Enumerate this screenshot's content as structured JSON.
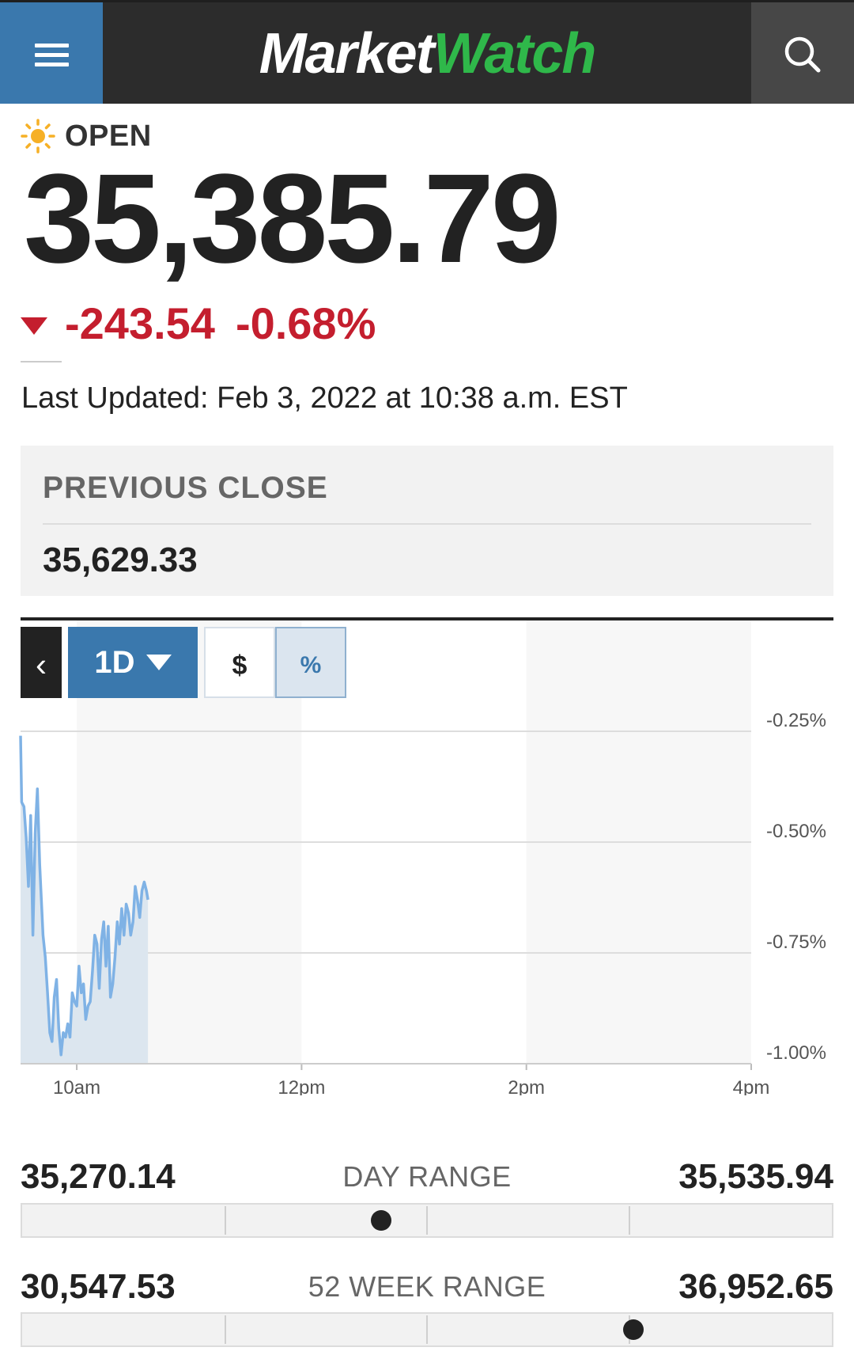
{
  "header": {
    "logo_part1": "Market",
    "logo_part2": "Watch",
    "menu_icon": "hamburger-menu-icon",
    "search_icon": "search-icon",
    "colors": {
      "bar": "#2c2c2c",
      "menu": "#3a78ad",
      "search": "#474747",
      "logo_green": "#2fb84a"
    }
  },
  "quote": {
    "market_status": "OPEN",
    "status_icon": "sun-icon",
    "price": "35,385.79",
    "change": "-243.54",
    "change_percent": "-0.68%",
    "direction_icon": "down-triangle-icon",
    "change_color": "#c41e2e",
    "last_updated": "Last Updated: Feb 3, 2022 at 10:38 a.m. EST"
  },
  "previous_close": {
    "label": "PREVIOUS CLOSE",
    "value": "35,629.33"
  },
  "chart_controls": {
    "back_label": "‹",
    "range_label": "1D",
    "dollar_label": "$",
    "percent_label": "%",
    "selected_mode": "%"
  },
  "chart_data": {
    "type": "area",
    "title": "",
    "xlabel": "",
    "ylabel": "",
    "x_ticks": [
      "10am",
      "12pm",
      "2pm",
      "4pm"
    ],
    "y_ticks": [
      "-0.25%",
      "-0.50%",
      "-0.75%",
      "-1.00%"
    ],
    "ylim": [
      -1.0,
      -0.2
    ],
    "xlim_hours": [
      9.5,
      16.0
    ],
    "grid": true,
    "line_color": "#7fb2e5",
    "fill_color": "#dce6ef",
    "series": [
      {
        "x": [
          9.5,
          9.51,
          9.53,
          9.55,
          9.57,
          9.59,
          9.61,
          9.63,
          9.65,
          9.67,
          9.7,
          9.72,
          9.74,
          9.76,
          9.78,
          9.8,
          9.82,
          9.84,
          9.86,
          9.88,
          9.9,
          9.92,
          9.94,
          9.96,
          9.98,
          10.0,
          10.02,
          10.04,
          10.06,
          10.08,
          10.1,
          10.12,
          10.14,
          10.16,
          10.18,
          10.2,
          10.22,
          10.24,
          10.26,
          10.28,
          10.3,
          10.32,
          10.34,
          10.36,
          10.38,
          10.4,
          10.42,
          10.44,
          10.46,
          10.48,
          10.5,
          10.52,
          10.54,
          10.56,
          10.58,
          10.6,
          10.62,
          10.633
        ],
        "y": [
          -0.26,
          -0.41,
          -0.42,
          -0.49,
          -0.6,
          -0.44,
          -0.71,
          -0.48,
          -0.38,
          -0.55,
          -0.71,
          -0.76,
          -0.84,
          -0.93,
          -0.95,
          -0.85,
          -0.81,
          -0.92,
          -0.98,
          -0.93,
          -0.94,
          -0.91,
          -0.94,
          -0.84,
          -0.86,
          -0.87,
          -0.78,
          -0.84,
          -0.82,
          -0.9,
          -0.87,
          -0.86,
          -0.79,
          -0.71,
          -0.73,
          -0.83,
          -0.72,
          -0.68,
          -0.78,
          -0.69,
          -0.85,
          -0.82,
          -0.76,
          -0.68,
          -0.73,
          -0.65,
          -0.71,
          -0.64,
          -0.66,
          -0.71,
          -0.68,
          -0.6,
          -0.63,
          -0.67,
          -0.61,
          -0.59,
          -0.61,
          -0.63
        ]
      }
    ]
  },
  "day_range": {
    "label": "DAY RANGE",
    "low": "35,270.14",
    "high": "35,535.94",
    "position": 0.443
  },
  "week52_range": {
    "label": "52 WEEK RANGE",
    "low": "30,547.53",
    "high": "36,952.65",
    "position": 0.755
  }
}
